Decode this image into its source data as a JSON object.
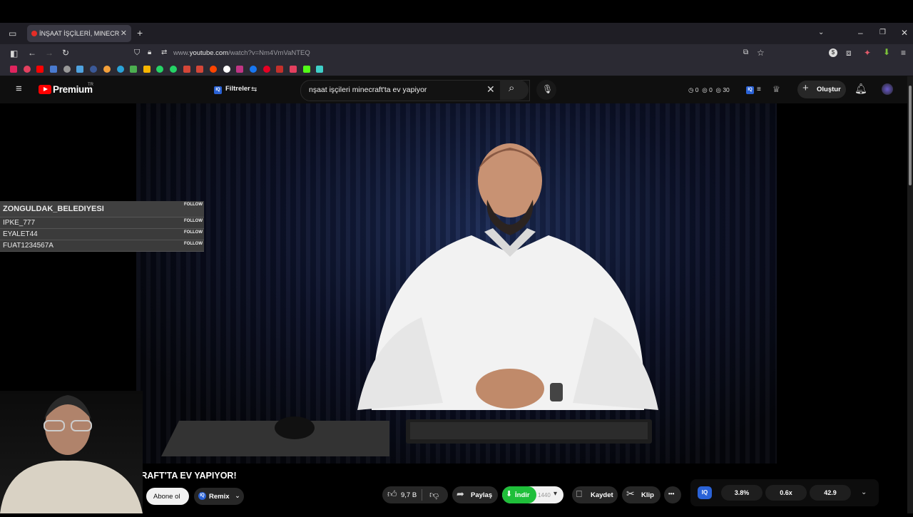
{
  "browser": {
    "tab_title": "İNŞAAT İŞÇİLERİ, MINECRAFT'TA EV YAPIYOR!",
    "new_tab": "+",
    "close_tab": "✕",
    "url_prefix": "www.",
    "url_domain": "youtube.com",
    "url_path": "/watch?v=Nm4VmVaNTEQ"
  },
  "youtube": {
    "brand": "Premium",
    "brand_region": "TR",
    "filters_label": "Filtreler",
    "search_value": "nşaat işçileri minecraft'ta ev yapiyor",
    "counters": [
      "0",
      "0",
      "30"
    ],
    "create_label": "Oluştur"
  },
  "chat_overlay": {
    "rows": [
      {
        "name": "ZONGULDAK_BELEDIYESI",
        "follow": "FOLLOW"
      },
      {
        "name": "IPKE_777",
        "follow": "FOLLOW"
      },
      {
        "name": "EYALET44",
        "follow": "FOLLOW"
      },
      {
        "name": "FUAT1234567A",
        "follow": "FOLLOW"
      }
    ]
  },
  "video": {
    "title": "ECRAFT'TA EV YAPIYOR!",
    "subscribe_label": "Abone ol",
    "remix_label": "Remix",
    "likes": "9,7 B",
    "share_label": "Paylaş",
    "download_label": "İndir",
    "download_quality": "1440",
    "save_label": "Kaydet",
    "clip_label": "Klip",
    "more_label": "•••"
  },
  "iq_panel": {
    "badge": "IQ",
    "stats": [
      "3.8%",
      "0.6x",
      "42.9"
    ]
  },
  "colors": {
    "yt_red": "#ff0000",
    "download_green": "#1fbf3a",
    "iq_blue": "#2a62d6"
  }
}
